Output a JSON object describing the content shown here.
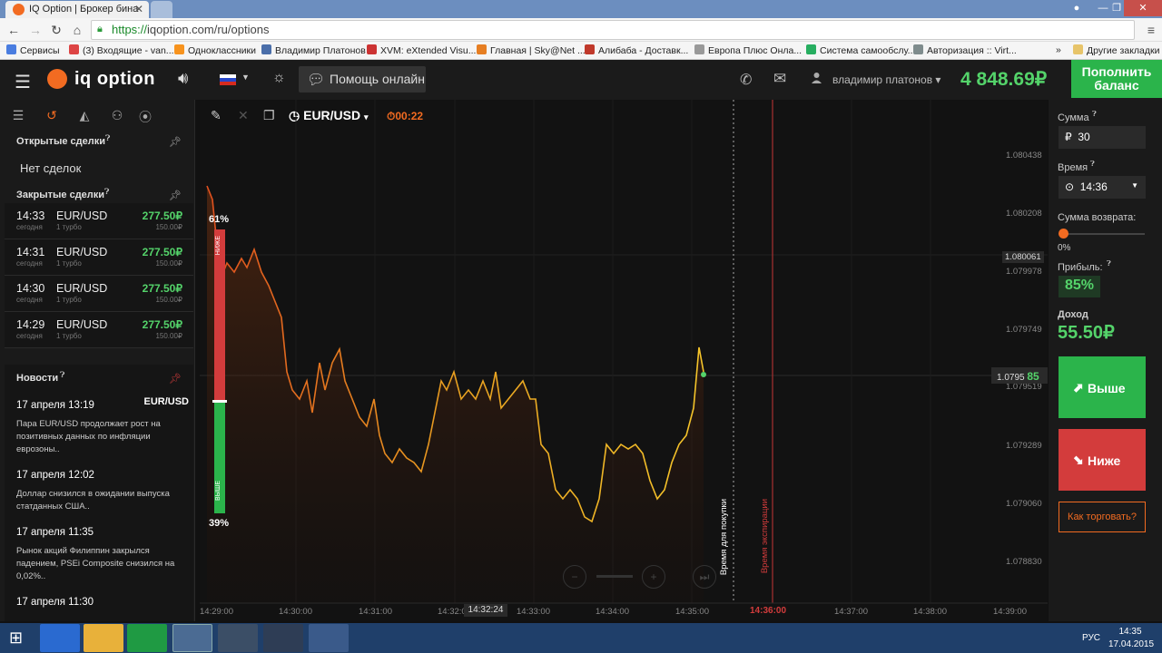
{
  "browser": {
    "tab_title": "IQ Option | Брокер бина",
    "url_https": "https://",
    "url_rest": "iqoption.com/ru/options",
    "bookmarks": [
      {
        "label": "Сервисы",
        "color": "#4a7de0"
      },
      {
        "label": "(3) Входящие - van...",
        "color": "#d44"
      },
      {
        "label": "Одноклассники",
        "color": "#f7931e"
      },
      {
        "label": "Владимир Платонов",
        "color": "#4a6ea9"
      },
      {
        "label": "XVM: eXtended Visu...",
        "color": "#c33"
      },
      {
        "label": "Главная | Sky@Net ...",
        "color": "#e67e22"
      },
      {
        "label": "Алибаба - Доставк...",
        "color": "#c0392b"
      },
      {
        "label": "Европа Плюс Онла...",
        "color": "#999"
      },
      {
        "label": "Система самообслу...",
        "color": "#27ae60"
      },
      {
        "label": "Авторизация :: Virt...",
        "color": "#7f8c8d"
      }
    ],
    "bookmarks_more": "»",
    "other_bookmarks": "Другие закладки"
  },
  "header": {
    "logo": "iq option",
    "help": "Помощь онлайн",
    "user": "владимир платонов",
    "balance": "4 848.69₽",
    "deposit": "Пополнить баланс"
  },
  "left": {
    "open_deals": "Открытые сделки",
    "no_deals": "Нет сделок",
    "closed_deals": "Закрытые сделки",
    "deals": [
      {
        "time": "14:33",
        "day": "сегодня",
        "pair": "EUR/USD",
        "type": "1 турбо",
        "profit": "277.50₽",
        "amount": "150.00₽"
      },
      {
        "time": "14:31",
        "day": "сегодня",
        "pair": "EUR/USD",
        "type": "1 турбо",
        "profit": "277.50₽",
        "amount": "150.00₽"
      },
      {
        "time": "14:30",
        "day": "сегодня",
        "pair": "EUR/USD",
        "type": "1 турбо",
        "profit": "277.50₽",
        "amount": "150.00₽"
      },
      {
        "time": "14:29",
        "day": "сегодня",
        "pair": "EUR/USD",
        "type": "1 турбо",
        "profit": "277.50₽",
        "amount": "150.00₽"
      }
    ],
    "news_title": "Новости",
    "news": [
      {
        "date": "17 апреля 13:19",
        "pair": "EUR/USD",
        "text": "Пара EUR/USD продолжает рост на позитивных данных по инфляции еврозоны.."
      },
      {
        "date": "17 апреля 12:02",
        "pair": "",
        "text": "Доллар снизился в ожидании выпуска статданных США.."
      },
      {
        "date": "17 апреля 11:35",
        "pair": "",
        "text": "Рынок акций Филиппин закрылся падением, PSEi Composite снизился на 0,02%.."
      },
      {
        "date": "17 апреля 11:30",
        "pair": "",
        "text": ""
      }
    ]
  },
  "chart": {
    "asset": "EUR/USD",
    "timer": "00:22",
    "pct_up": "61%",
    "pct_down": "39%",
    "label_down": "НИЖЕ",
    "label_up": "ВЫШЕ",
    "buy_time": "Время для покупки",
    "expiration_time": "Время экспирации",
    "expiration_clock": "14:36:00",
    "hover_time": "14:32:24",
    "current_price": "1.0795",
    "current_price_tail": "85",
    "price_ticks": [
      "1.080438",
      "1.080208",
      "1.080061",
      "1.079978",
      "1.079749",
      "1.079519",
      "1.079289",
      "1.079060",
      "1.078830"
    ],
    "time_ticks": [
      "14:29:00",
      "14:30:00",
      "14:31:00",
      "14:32:00",
      "14:33:00",
      "14:34:00",
      "14:35:00",
      "14:37:00",
      "14:38:00",
      "14:39:00"
    ]
  },
  "right": {
    "amount_label": "Сумма",
    "amount_value": "30",
    "time_label": "Время",
    "time_value": "14:36",
    "return_label": "Сумма возврата:",
    "return_value": "0%",
    "profit_label": "Прибыль:",
    "profit_value": "85%",
    "income_label": "Доход",
    "income_value": "55.50₽",
    "btn_up": "Выше",
    "btn_down": "Ниже",
    "how_to_trade": "Как торговать?"
  },
  "taskbar": {
    "lang": "РУС",
    "time": "14:35",
    "date": "17.04.2015"
  }
}
